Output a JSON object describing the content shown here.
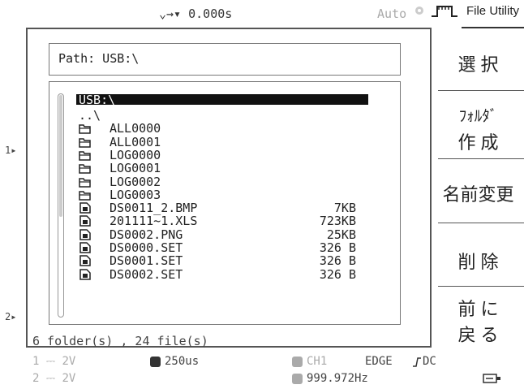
{
  "topbar": {
    "trigger_label": "⌄→▾ 0.000s",
    "auto_label": "Auto",
    "menu_title": "File Utility"
  },
  "path": {
    "text": "Path: USB:\\"
  },
  "files": {
    "selected": "USB:\\",
    "rows": [
      {
        "icon": "parent",
        "name": "..\\",
        "size": ""
      },
      {
        "icon": "folder",
        "name": "ALL0000",
        "size": ""
      },
      {
        "icon": "folder",
        "name": "ALL0001",
        "size": ""
      },
      {
        "icon": "folder",
        "name": "LOG0000",
        "size": ""
      },
      {
        "icon": "folder",
        "name": "LOG0001",
        "size": ""
      },
      {
        "icon": "folder",
        "name": "LOG0002",
        "size": ""
      },
      {
        "icon": "folder",
        "name": "LOG0003",
        "size": ""
      },
      {
        "icon": "file",
        "name": "DS0011_2.BMP",
        "size": "7KB"
      },
      {
        "icon": "file",
        "name": "201111~1.XLS",
        "size": "723KB"
      },
      {
        "icon": "file",
        "name": "DS0002.PNG",
        "size": "25KB"
      },
      {
        "icon": "file",
        "name": "DS0000.SET",
        "size": "326 B"
      },
      {
        "icon": "file",
        "name": "DS0001.SET",
        "size": "326 B"
      },
      {
        "icon": "file",
        "name": "DS0002.SET",
        "size": "326 B"
      }
    ],
    "status": "6 folder(s) , 24 file(s)"
  },
  "markers": {
    "ch1": "1▸",
    "ch2": "2▸"
  },
  "side_menu": {
    "select": "選 択",
    "new_folder_1": "ﾌｫﾙﾀﾞ",
    "new_folder_2": "作 成",
    "rename": "名前変更",
    "delete": "削 除",
    "back_1": "前 に",
    "back_2": "戻 る"
  },
  "bottom": {
    "ch1_scale": "1 ⎓ 2V",
    "ch2_scale": "2 ⎓ 2V",
    "timebase": "250us",
    "trigger_source": "CH1",
    "trigger_type": "EDGE",
    "coupling": "DC",
    "frequency": "999.972Hz"
  }
}
